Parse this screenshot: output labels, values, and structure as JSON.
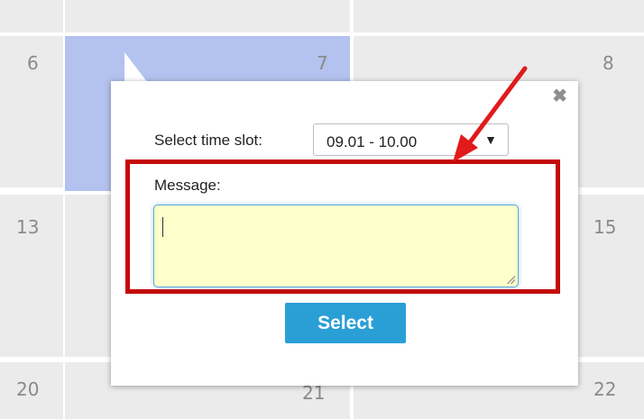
{
  "calendar": {
    "days": [
      "6",
      "7",
      "8",
      "13",
      "15",
      "20",
      "21",
      "22"
    ]
  },
  "popup": {
    "time_slot_label": "Select time slot:",
    "time_slot_value": "09.01 - 10.00",
    "message_label": "Message:",
    "message_value": "",
    "select_label": "Select"
  },
  "annotation": {
    "highlight_color": "#c40a0a",
    "arrow_color": "#e11a1a"
  }
}
